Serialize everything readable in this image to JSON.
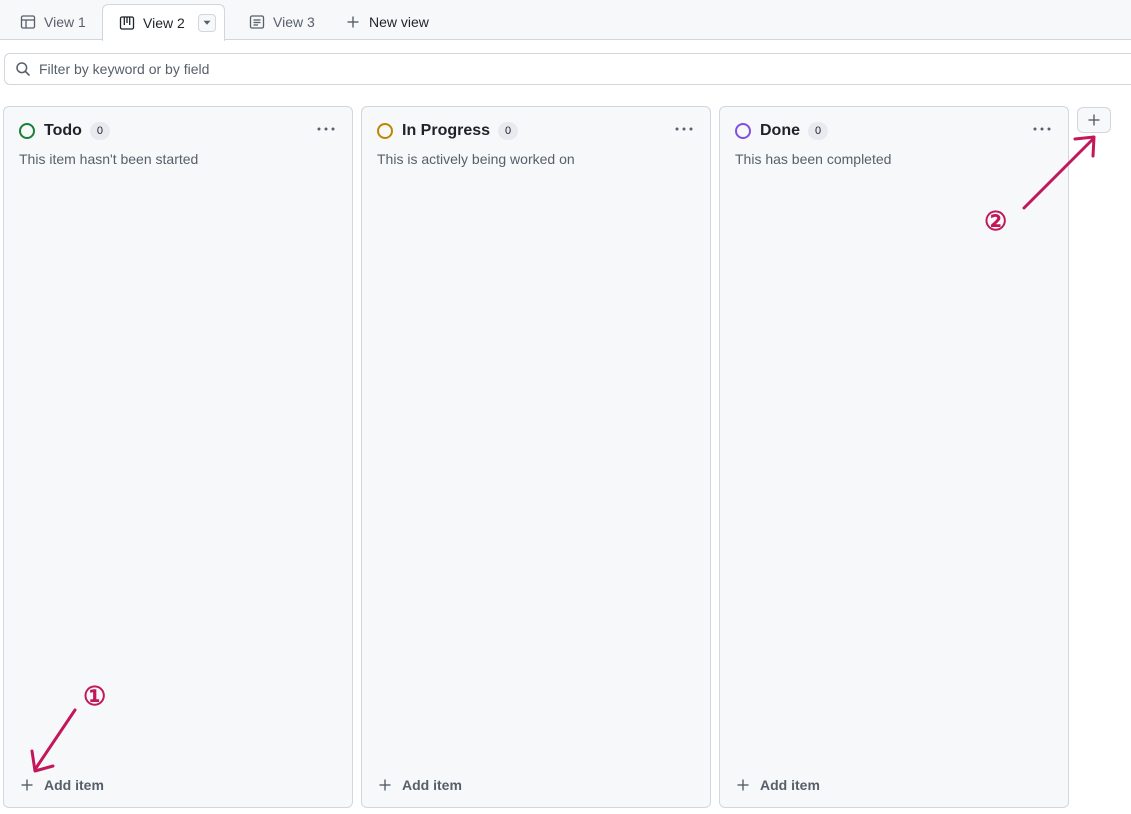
{
  "tabs": [
    {
      "label": "View 1",
      "icon": "table-icon"
    },
    {
      "label": "View 2",
      "icon": "board-icon",
      "active": true
    },
    {
      "label": "View 3",
      "icon": "roadmap-icon"
    }
  ],
  "new_view_label": "New view",
  "filter": {
    "placeholder": "Filter by keyword or by field"
  },
  "columns": [
    {
      "title": "Todo",
      "count": "0",
      "description": "This item hasn't been started",
      "color": "#1a7f37",
      "add_label": "Add item"
    },
    {
      "title": "In Progress",
      "count": "0",
      "description": "This is actively being worked on",
      "color": "#bf8700",
      "add_label": "Add item"
    },
    {
      "title": "Done",
      "count": "0",
      "description": "This has been completed",
      "color": "#8250df",
      "add_label": "Add item"
    }
  ],
  "annotations": [
    {
      "label": "①",
      "color": "#c2185b"
    },
    {
      "label": "②",
      "color": "#c2185b"
    }
  ]
}
